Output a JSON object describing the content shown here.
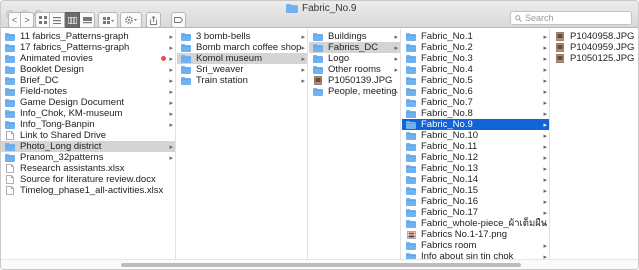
{
  "window": {
    "title": "Fabric_No.9"
  },
  "search": {
    "placeholder": "Search"
  },
  "toolbar": {
    "nav": [
      "<",
      ">"
    ],
    "view_buttons": [
      "icon-view-icon",
      "list-view-icon",
      "column-view-icon",
      "cover-flow-icon"
    ],
    "arrange_icon": "arrange-grid-icon",
    "action_icon": "gear-icon",
    "share_icon": "share-icon",
    "tag_icon": "tag-icon"
  },
  "colors": {
    "selection": "#1163d6",
    "folder": "#6fb2ef",
    "tag_red": "#ef4c48"
  },
  "columns": [
    {
      "items": [
        {
          "label": "11 fabrics_Patterns-graph",
          "icon": "folder",
          "arrow": true
        },
        {
          "label": "17 fabrics_Patterns-graph",
          "icon": "folder",
          "arrow": true
        },
        {
          "label": "Animated movies",
          "icon": "folder",
          "arrow": true,
          "tag": "red"
        },
        {
          "label": "Booklet Design",
          "icon": "folder",
          "arrow": true
        },
        {
          "label": "Brief_DC",
          "icon": "folder",
          "arrow": true
        },
        {
          "label": "Field-notes",
          "icon": "folder",
          "arrow": true
        },
        {
          "label": "Game Design Document",
          "icon": "folder",
          "arrow": true
        },
        {
          "label": "Info_Chok, KM-museum",
          "icon": "folder",
          "arrow": true
        },
        {
          "label": "Info_Tong-Banpin",
          "icon": "folder",
          "arrow": true
        },
        {
          "label": "Link to Shared Drive",
          "icon": "doc",
          "arrow": false
        },
        {
          "label": "Photo_Long district",
          "icon": "folder",
          "arrow": true,
          "state": "dimsel"
        },
        {
          "label": "Pranom_32patterns",
          "icon": "folder",
          "arrow": true
        },
        {
          "label": "Research assistants.xlsx",
          "icon": "doc",
          "arrow": false
        },
        {
          "label": "Source for literature review.docx",
          "icon": "doc",
          "arrow": false
        },
        {
          "label": "Timelog_phase1_all-activities.xlsx",
          "icon": "doc",
          "arrow": false
        }
      ]
    },
    {
      "items": [
        {
          "label": "3 bomb-bells",
          "icon": "folder",
          "arrow": true
        },
        {
          "label": "Bomb march coffee shop",
          "icon": "folder",
          "arrow": true
        },
        {
          "label": "Komol museum",
          "icon": "folder",
          "arrow": true,
          "state": "dimsel"
        },
        {
          "label": "Sri_weaver",
          "icon": "folder",
          "arrow": true
        },
        {
          "label": "Train station",
          "icon": "folder",
          "arrow": true
        }
      ]
    },
    {
      "items": [
        {
          "label": "Buildings",
          "icon": "folder",
          "arrow": true
        },
        {
          "label": "Fabrics_DC",
          "icon": "folder",
          "arrow": true,
          "state": "dimsel"
        },
        {
          "label": "Logo",
          "icon": "folder",
          "arrow": true
        },
        {
          "label": "Other rooms",
          "icon": "folder",
          "arrow": true
        },
        {
          "label": "P1050139.JPG",
          "icon": "image",
          "arrow": false
        },
        {
          "label": "People, meeting",
          "icon": "folder",
          "arrow": true
        }
      ]
    },
    {
      "items": [
        {
          "label": "Fabric_No.1",
          "icon": "folder",
          "arrow": true
        },
        {
          "label": "Fabric_No.2",
          "icon": "folder",
          "arrow": true
        },
        {
          "label": "Fabric_No.3",
          "icon": "folder",
          "arrow": true
        },
        {
          "label": "Fabric_No.4",
          "icon": "folder",
          "arrow": true
        },
        {
          "label": "Fabric_No.5",
          "icon": "folder",
          "arrow": true
        },
        {
          "label": "Fabric_No.6",
          "icon": "folder",
          "arrow": true
        },
        {
          "label": "Fabric_No.7",
          "icon": "folder",
          "arrow": true
        },
        {
          "label": "Fabric_No.8",
          "icon": "folder",
          "arrow": true
        },
        {
          "label": "Fabric_No.9",
          "icon": "folder",
          "arrow": true,
          "state": "selected"
        },
        {
          "label": "Fabric_No.10",
          "icon": "folder",
          "arrow": true
        },
        {
          "label": "Fabric_No.11",
          "icon": "folder",
          "arrow": true
        },
        {
          "label": "Fabric_No.12",
          "icon": "folder",
          "arrow": true
        },
        {
          "label": "Fabric_No.13",
          "icon": "folder",
          "arrow": true
        },
        {
          "label": "Fabric_No.14",
          "icon": "folder",
          "arrow": true
        },
        {
          "label": "Fabric_No.15",
          "icon": "folder",
          "arrow": true
        },
        {
          "label": "Fabric_No.16",
          "icon": "folder",
          "arrow": true
        },
        {
          "label": "Fabric_No.17",
          "icon": "folder",
          "arrow": true
        },
        {
          "label": "Fabric_whole-piece_ผ้าเต็มผืน",
          "icon": "folder",
          "arrow": true
        },
        {
          "label": "Fabrics No.1-17.png",
          "icon": "image-png",
          "arrow": false
        },
        {
          "label": "Fabrics room",
          "icon": "folder",
          "arrow": true
        },
        {
          "label": "Info about sin tin chok",
          "icon": "folder",
          "arrow": true
        }
      ]
    },
    {
      "items": [
        {
          "label": "P1040958.JPG",
          "icon": "image",
          "arrow": false
        },
        {
          "label": "P1040959.JPG",
          "icon": "image",
          "arrow": false
        },
        {
          "label": "P1050125.JPG",
          "icon": "image",
          "arrow": false
        }
      ]
    }
  ]
}
